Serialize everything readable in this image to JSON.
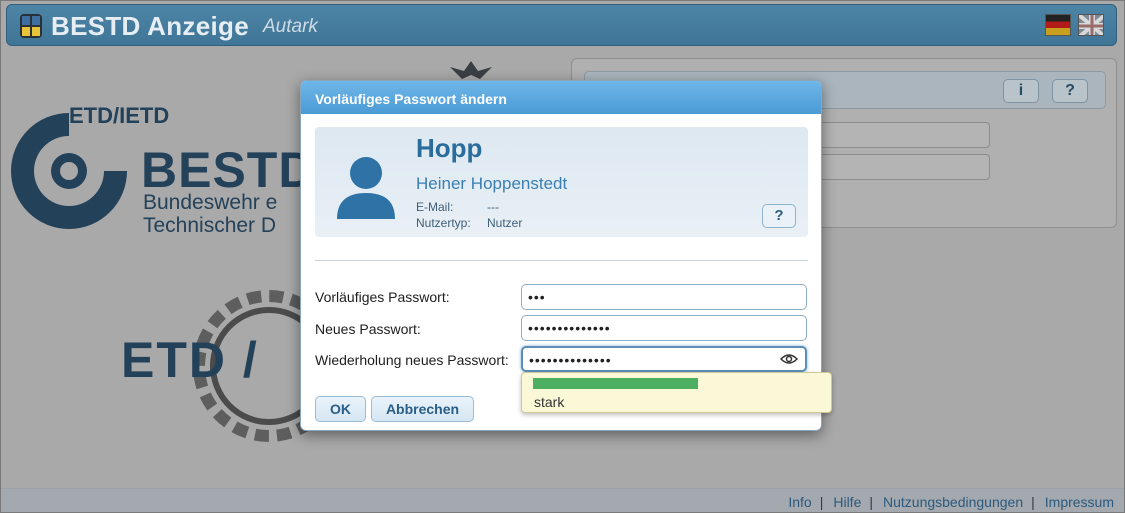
{
  "app": {
    "title": "BESTD Anzeige",
    "subtitle": "Autark",
    "languages": [
      "Deutsch",
      "English"
    ]
  },
  "background": {
    "etd_ietd": "ETD/IETD",
    "bestd": "BESTD",
    "line1": "Bundeswehr e",
    "line2": "Technischer D",
    "etd_big": "ETD /",
    "panel_info_label": "i",
    "panel_help_label": "?"
  },
  "dialog": {
    "title": "Vorläufiges Passwort ändern",
    "user": {
      "short_name": "Hopp",
      "full_name": "Heiner Hoppenstedt",
      "email_label": "E-Mail:",
      "email_value": "---",
      "type_label": "Nutzertyp:",
      "type_value": "Nutzer"
    },
    "help_label": "?",
    "fields": {
      "temp_label": "Vorläufiges Passwort:",
      "temp_value": "•••",
      "new_label": "Neues Passwort:",
      "new_value": "••••••••••••••",
      "repeat_label": "Wiederholung neues Passwort:",
      "repeat_value": "••••••••••••••"
    },
    "ok_label": "OK",
    "cancel_label": "Abbrechen",
    "strength": {
      "level": 0.53,
      "color": "#4caf62",
      "text": "stark"
    }
  },
  "footer": {
    "links": [
      "Info",
      "Hilfe",
      "Nutzungsbedingungen",
      "Impressum"
    ]
  }
}
